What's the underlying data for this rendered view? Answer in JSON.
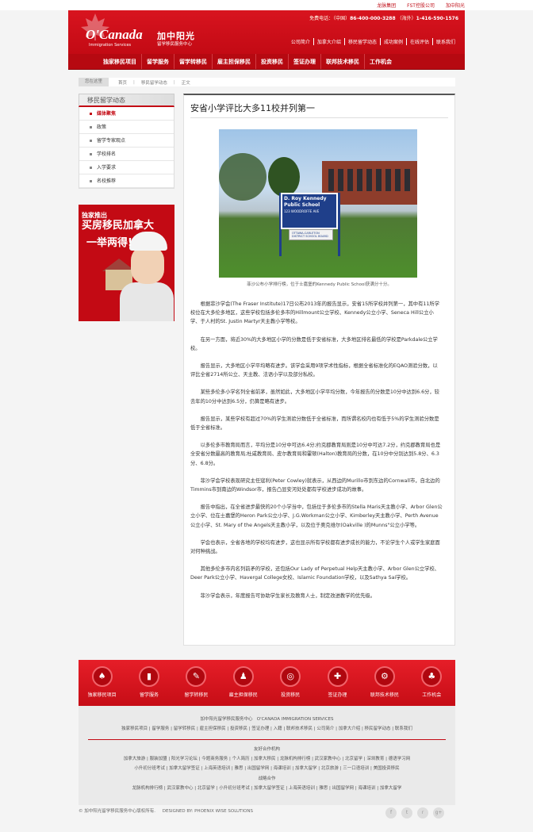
{
  "top_links": [
    "龙脉集团",
    "FST控股公司",
    "加中阳光"
  ],
  "brand": {
    "logo": "O'Canada",
    "logo_sub": "Immigration Services",
    "cn_name": "加中阳光",
    "cn_sub": "留学移民服务中心"
  },
  "hotline": {
    "label": "免费电话：（中国）",
    "china": "86-400-000-3288",
    "overseas_label": "（海外）",
    "overseas": "1-416-590-1576"
  },
  "sub_nav": [
    "公司简介",
    "加拿大介绍",
    "移民留学动态",
    "成功案例",
    "在线评估",
    "联系我们"
  ],
  "main_nav": [
    "独家移民项目",
    "留学服务",
    "留学转移民",
    "雇主担保移民",
    "投资移民",
    "签证办理",
    "联邦技术移民",
    "工作机会"
  ],
  "breadcrumb": {
    "here": "您在这里",
    "items": [
      "首页",
      "移民留学动态",
      "正文"
    ]
  },
  "sidebar": {
    "title": "移民留学动态",
    "items": [
      "媒体聚焦",
      "政策",
      "留学专家观点",
      "学校排名",
      "入学要求",
      "名校推荐"
    ],
    "active": 0
  },
  "ad": {
    "line1": "独家推出",
    "line2": "买房移民加拿大",
    "line3": "一举两得!"
  },
  "article": {
    "title": "安省小学评比大多11校并列第一",
    "photo": {
      "sign_line1": "D. Roy Kennedy",
      "sign_line2": "Public School",
      "sign_line3": "123 WOODROFFE AVE",
      "sign_bottom1": "OTTAWA-CARLETON",
      "sign_bottom2": "DISTRICT SCHOOL BOARD"
    },
    "caption": "菲沙公布小学排行榜，位于士嘉堡的Kennedy Public School获满分十分。",
    "paragraphs": [
      "根据菲沙学会(The Fraser Institute)17日公布2013年的报告显示，安省15所学校并列第一，其中有11所学校位在大多伦多地区，这些学校包括多伦多市的Hillmount公立学校、Kennedy公立小学、Seneca Hill公立小学、于人村的St. Justin Martyr天主教小学等校。",
      "在另一方面，将近30%的大多地区小学的分数是低于安省标准，大多地区排名最低的学校是Parkdale公立学校。",
      "报告显示，大多地区小学平均略有进步。该学会采用9项学术性指标，根据全省标准化的EQAO测验分数，以评比全省2714所公立、天主教、法语小学以及部分私校。",
      "某些多伦多小学名列全省前茅，虽然如此，大多地区小学平均分数，今年报告的分数是10分中达到6.6分，较去年的10分中达到6.5分，仍算是略有进步。",
      "报告显示，某些学校有超过70%的学生测验分数低于全省标准，而所谓名校内也有低于5%的学生测验分数是低于全省标准。",
      "以多伦多市教育局而言，平均分是10分中可达6.4分;约克郡教育局则是10分中可达7.2分，约克郡教育局也是全安省分数最高的教育局;杜咸教育局、皮尔教育局和霍顿(Halton)教育局的分数，在10分中分别达到5.8分、6.3分、6.8分。",
      "菲沙学会学校表现研究主任寇利(Peter Cowley)就表示，从西边的Murillo市到东边的Cornwall市，自北边的Timmins市到南边的Windsor市，报告凸显安河处处都有学校进步成功的故事。",
      "报告中指出，在全省进步最快的20个小学当中，包括位于多伦多市的Stella Maris天主教小学、Arbor Glen公立小学、位在士嘉堡的Heron Park公立小学、J.G.Workman公立小学、Kimberley天主教小学、Perth Avenue公立小学、St. Mary of the Angels天主教小学，以及位于奥克维尔(Oakville )的Munns\"公立小学等。",
      "学会也表示，全省各地的学校均有进步，这也显示所有学校都有进步成长的能力，不论学生个人或学生家庭面对何种挑战。",
      "其他多伦多市内名列前矛的学校，还包括Our Lady of Perpetual Help天主教小学、Arbor Glen公立学校、Deer Park公立小学、Havergal College女校、Islamic Foundation学校，以及Sathya Sai学校。",
      "菲沙学会表示，年度报告可协助学生家长及教育人士，制定改进教学的优先级。"
    ]
  },
  "footer_icons": [
    {
      "label": "独家移民项目",
      "glyph": "♠"
    },
    {
      "label": "留学服务",
      "glyph": "▮"
    },
    {
      "label": "留学转移民",
      "glyph": "✎"
    },
    {
      "label": "雇主担保移民",
      "glyph": "♟"
    },
    {
      "label": "投资移民",
      "glyph": "◎"
    },
    {
      "label": "签证办理",
      "glyph": "✚"
    },
    {
      "label": "联邦技术移民",
      "glyph": "⚙"
    },
    {
      "label": "工作机会",
      "glyph": "♣"
    }
  ],
  "footer": {
    "center": "加中阳光留学移民服务中心",
    "center_en": "O'CANADA IMMIGRATION SERVICES",
    "links": "独家移民项目 | 留学服务 | 留学转移民 | 雇主担保移民 | 投资移民 | 签证办理 | 入籍 | 联邦技术移民 | 公司简介 | 加拿大介绍 | 移民留学动态 | 联系我们",
    "partners_title": "友好合作机构",
    "partners1": "加拿大旅游 | 服装加盟 | 阳光学习论坛 | 今题商务服务 | 个人简历 | 加拿大移民 | 龙脉机构排行榜 | 武汉家教中心 | 北京留学 | 深圳教育 | 德语学习网",
    "partners2": "小升初分班考试 | 加拿大留学签证 | 上海英语培训 | 雅思 | 出国留学网 | 海课培训 | 加拿大留学 | 北京旅游 | 三一口语培训 | 美国投资移民",
    "strategy_title": "战略合作",
    "strategy": "龙脉机构排行榜 | 武汉家教中心 | 北京留学 | 小升初分班考试 | 加拿大留学签证 | 上海英语培训 | 雅思 | 出国留学网 | 海课培训 | 加拿大留学",
    "copyright": "© 加中阳光留学移民服务中心版权所有.",
    "designed": "DESIGNED BY: PHOENIX WISE SOLUTIONS"
  },
  "social": [
    "f",
    "t",
    "r",
    "g+"
  ],
  "colors": {
    "brand_red": "#c30a14",
    "dark_red": "#b60911"
  }
}
